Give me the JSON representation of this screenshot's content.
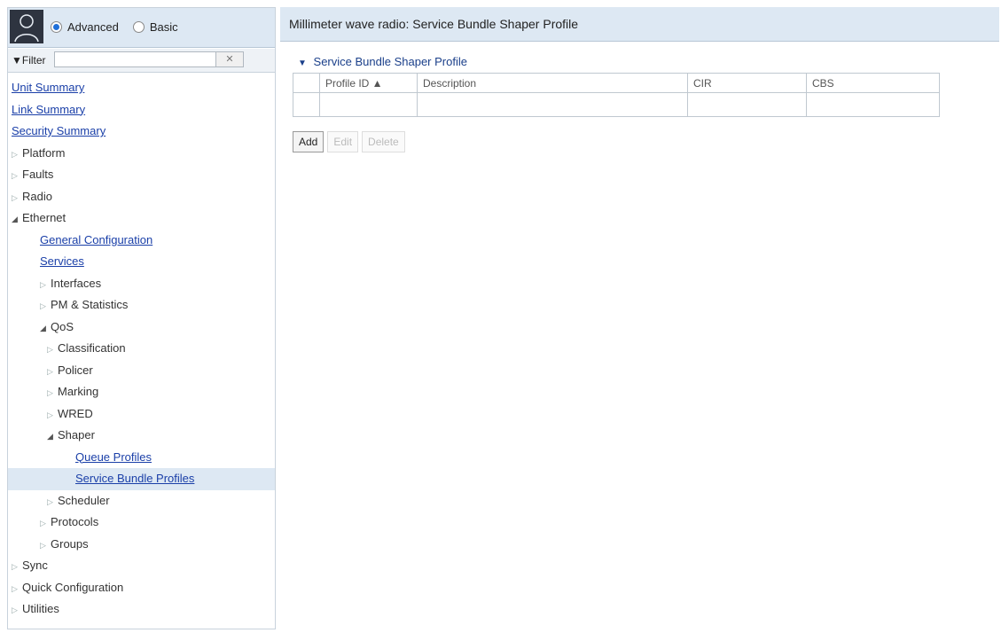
{
  "sidebar": {
    "mode": {
      "advanced_label": "Advanced",
      "basic_label": "Basic",
      "selected": "Advanced"
    },
    "filter": {
      "label": "▼Filter",
      "value": "",
      "clear_symbol": "✕"
    },
    "tree": [
      {
        "label": "Unit Summary",
        "level": 0,
        "link": true
      },
      {
        "label": "Link Summary",
        "level": 0,
        "link": true
      },
      {
        "label": "Security Summary",
        "level": 0,
        "link": true
      },
      {
        "label": "Platform",
        "level": 0,
        "arrow": "▷"
      },
      {
        "label": "Faults",
        "level": 0,
        "arrow": "▷"
      },
      {
        "label": "Radio",
        "level": 0,
        "arrow": "▷"
      },
      {
        "label": "Ethernet",
        "level": 0,
        "arrow": "◢",
        "open": true
      },
      {
        "label": "General Configuration",
        "level": 1,
        "link": true
      },
      {
        "label": "Services",
        "level": 1,
        "link": true
      },
      {
        "label": "Interfaces",
        "level": 1,
        "arrow": "▷"
      },
      {
        "label": "PM & Statistics",
        "level": 1,
        "arrow": "▷"
      },
      {
        "label": "QoS",
        "level": 1,
        "arrow": "◢",
        "open": true
      },
      {
        "label": "Classification",
        "level": 2,
        "arrow": "▷"
      },
      {
        "label": "Policer",
        "level": 2,
        "arrow": "▷"
      },
      {
        "label": "Marking",
        "level": 2,
        "arrow": "▷"
      },
      {
        "label": "WRED",
        "level": 2,
        "arrow": "▷"
      },
      {
        "label": "Shaper",
        "level": 2,
        "arrow": "◢",
        "open": true
      },
      {
        "label": "Queue Profiles",
        "level": 3,
        "link": true
      },
      {
        "label": "Service Bundle Profiles",
        "level": 3,
        "link": true,
        "selected": true
      },
      {
        "label": "Scheduler",
        "level": 2,
        "arrow": "▷"
      },
      {
        "label": "Protocols",
        "level": 1,
        "arrow": "▷"
      },
      {
        "label": "Groups",
        "level": 1,
        "arrow": "▷"
      },
      {
        "label": "Sync",
        "level": 0,
        "arrow": "▷"
      },
      {
        "label": "Quick Configuration",
        "level": 0,
        "arrow": "▷"
      },
      {
        "label": "Utilities",
        "level": 0,
        "arrow": "▷"
      }
    ]
  },
  "header": {
    "title": "Millimeter wave radio: Service Bundle Shaper Profile"
  },
  "main": {
    "section_title": "Service Bundle Shaper Profile",
    "columns": [
      "",
      "Profile ID ▲",
      "Description",
      "CIR",
      "CBS"
    ],
    "rows": [
      [
        "",
        "",
        "",
        "",
        ""
      ]
    ],
    "buttons": {
      "add": "Add",
      "edit": "Edit",
      "delete": "Delete"
    }
  },
  "colors": {
    "header_bg": "#dde8f3",
    "link": "#1a3fa8",
    "selected_bg": "#dde8f3"
  }
}
